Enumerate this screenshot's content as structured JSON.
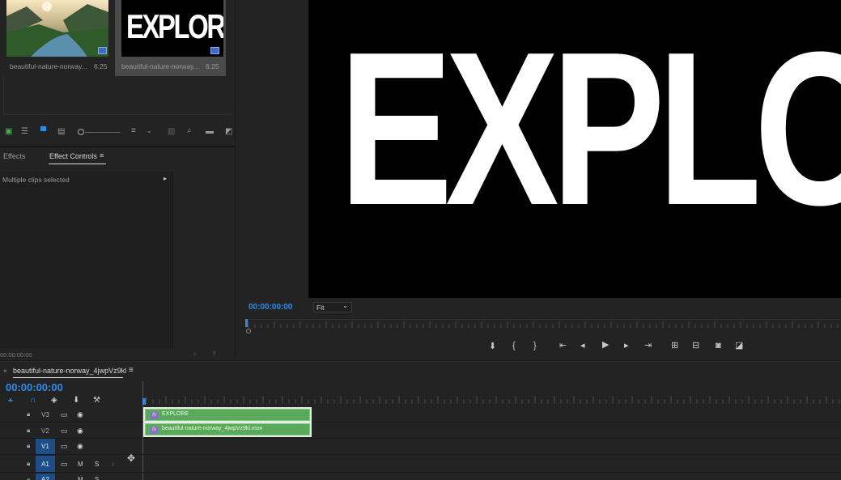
{
  "project": {
    "items": [
      {
        "name": "beautiful-nature-norway...",
        "duration": "6:25"
      },
      {
        "name": "beautiful-nature-norway...",
        "duration": "6:25",
        "thumb_text": "EXPLORE"
      }
    ]
  },
  "effects": {
    "tab_effects": "Effects",
    "tab_effect_controls": "Effect Controls",
    "status": "Multiple clips selected",
    "timecode": "00:00:00:00"
  },
  "program": {
    "frame_text": "EXPLORE",
    "timecode": "00:00:00:00",
    "zoom": "Fit"
  },
  "timeline": {
    "sequence_name": "beautiful-nature-norway_4jwpVz9kl",
    "timecode": "00:00:00:00",
    "tracks": {
      "v3": "V3",
      "v2": "V2",
      "v1": "V1",
      "a1": "A1",
      "a2": "A2",
      "m": "M",
      "s": "S"
    },
    "clips": {
      "title_clip": "EXPLORE",
      "video_clip": "beautiful-nature-norway_4jwpVz9kl.mov",
      "fx_label": "fx"
    }
  },
  "colors": {
    "accent_blue": "#2d8ceb",
    "clip_green": "#5aa85a",
    "panel_bg": "#232323"
  }
}
